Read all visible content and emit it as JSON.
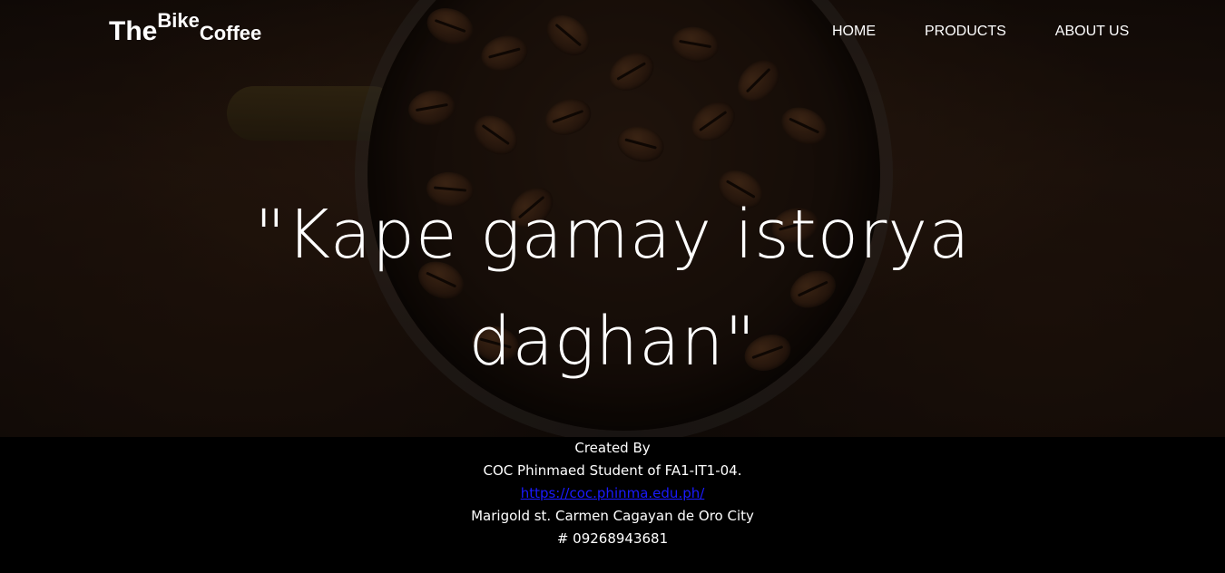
{
  "header": {
    "logo": {
      "the": "The",
      "bike": "Bike",
      "coffee": "Coffee"
    },
    "nav": [
      {
        "label": "HOME"
      },
      {
        "label": "PRODUCTS"
      },
      {
        "label": "ABOUT US"
      }
    ]
  },
  "hero": {
    "slogan_line1": "\"Kape gamay istorya",
    "slogan_line2": "daghan\""
  },
  "footer": {
    "created_by": "Created By",
    "author": "COC Phinmaed Student of FA1-IT1-04.",
    "link_text": "https://coc.phinma.edu.ph/",
    "address": "Marigold st. Carmen Cagayan de Oro City",
    "phone": "# 09268943681"
  }
}
